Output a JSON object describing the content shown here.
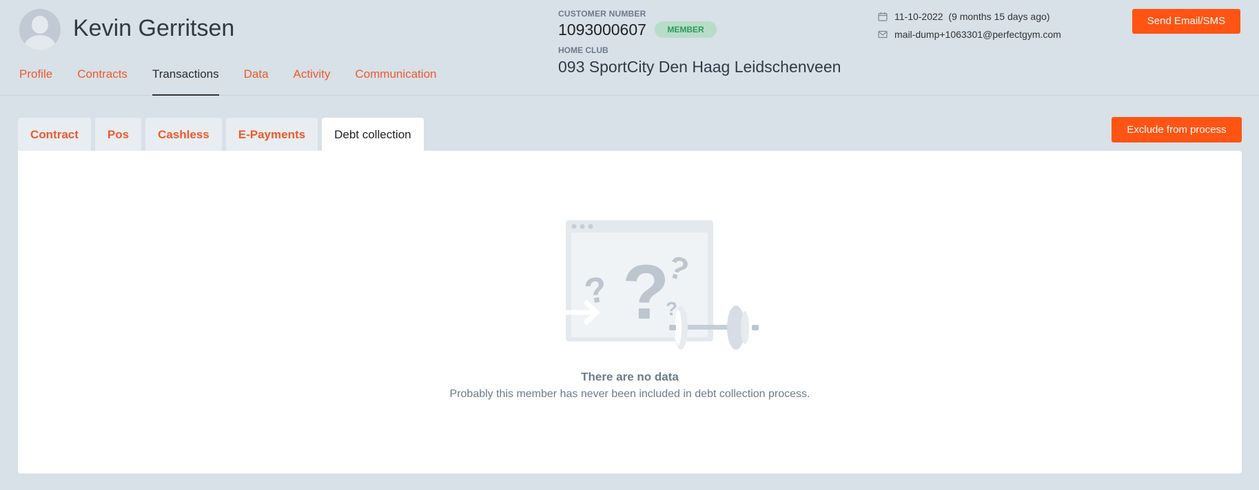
{
  "member": {
    "name": "Kevin Gerritsen"
  },
  "main_nav": [
    {
      "label": "Profile"
    },
    {
      "label": "Contracts"
    },
    {
      "label": "Transactions"
    },
    {
      "label": "Data"
    },
    {
      "label": "Activity"
    },
    {
      "label": "Communication"
    }
  ],
  "customer": {
    "number_label": "CUSTOMER NUMBER",
    "number": "1093000607",
    "badge": "MEMBER",
    "home_club_label": "HOME CLUB",
    "home_club": "093 SportCity Den Haag Leidschenveen"
  },
  "info": {
    "date": "11-10-2022  (9 months 15 days ago)",
    "email": "mail-dump+1063301@perfectgym.com"
  },
  "buttons": {
    "send": "Send Email/SMS",
    "exclude": "Exclude from process"
  },
  "sub_tabs": [
    {
      "label": "Contract"
    },
    {
      "label": "Pos"
    },
    {
      "label": "Cashless"
    },
    {
      "label": "E-Payments"
    },
    {
      "label": "Debt collection"
    }
  ],
  "empty_state": {
    "title": "There are no data",
    "description": "Probably this member has never been included in debt collection process."
  },
  "colors": {
    "accent": "#ff5413",
    "link": "#ef5a2a",
    "background": "#d8e0e8",
    "badge_bg": "#b8dcc8",
    "badge_text": "#2a9a5a"
  },
  "icons": [
    "calendar-icon",
    "mail-icon",
    "avatar-placeholder",
    "empty-state-illustration"
  ]
}
